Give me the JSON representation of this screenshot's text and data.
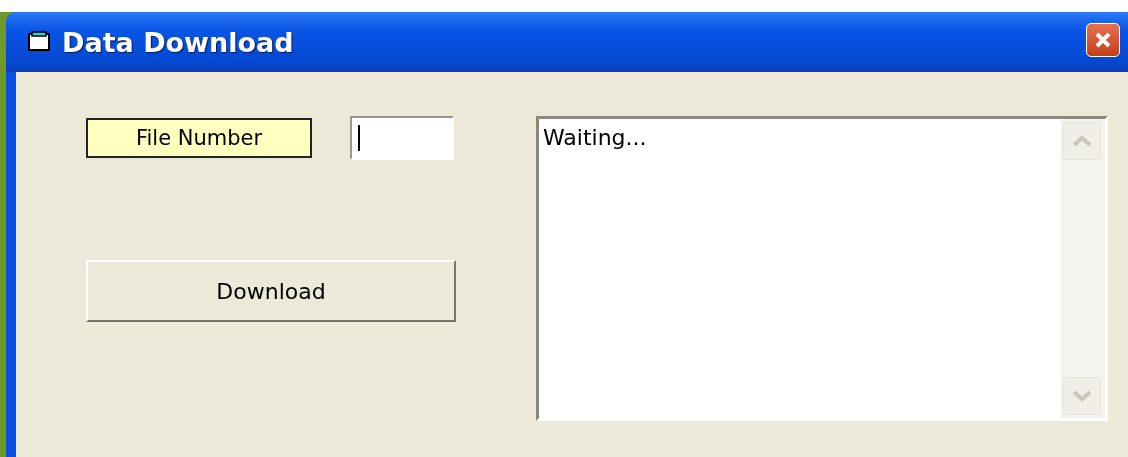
{
  "window": {
    "title": "Data Download"
  },
  "file_number": {
    "label": "File Number"
  },
  "download_button": {
    "label": "Download"
  },
  "log": {
    "text": "Waiting...",
    "scroll_up_disabled": true,
    "scroll_down_disabled": true
  }
}
